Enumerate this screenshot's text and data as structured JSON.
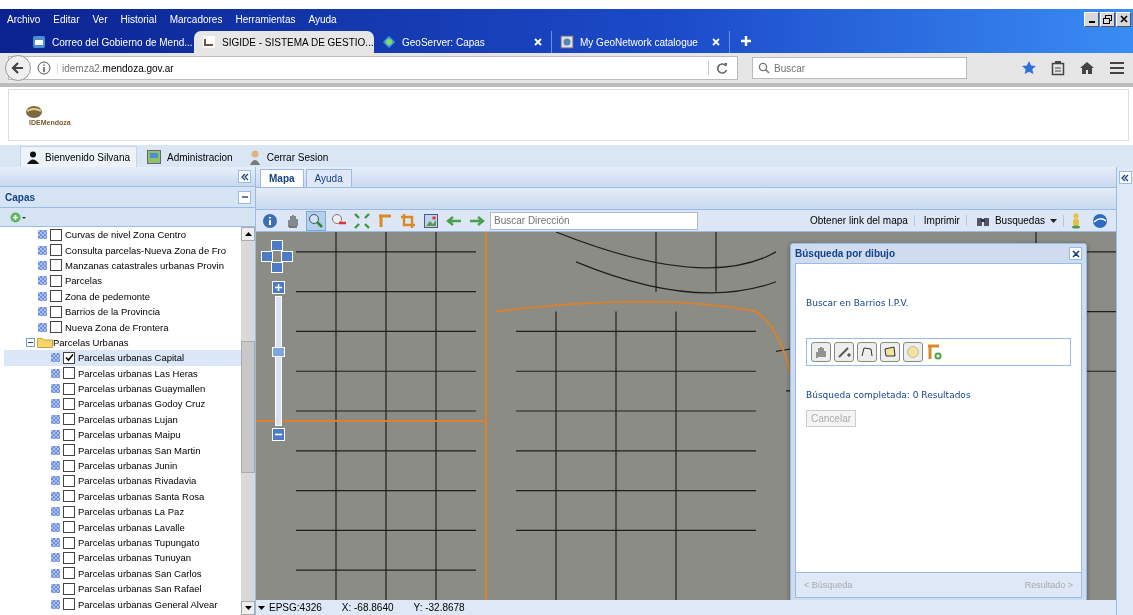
{
  "browser": {
    "menu": [
      "Archivo",
      "Editar",
      "Ver",
      "Historial",
      "Marcadores",
      "Herramientas",
      "Ayuda"
    ],
    "tabs": [
      {
        "title": "Correo del Gobierno de Mend...",
        "selected": false,
        "kind": "mail"
      },
      {
        "title": "SIGIDE - SISTEMA DE GESTIO...",
        "selected": true,
        "kind": "sigide"
      },
      {
        "title": "GeoServer: Capas",
        "selected": false,
        "kind": "geoserver"
      },
      {
        "title": "My GeoNetwork catalogue",
        "selected": false,
        "kind": "geonetwork"
      }
    ],
    "address": {
      "subdomain": "idemza2.",
      "domain": "mendoza.gov.ar"
    },
    "search": {
      "placeholder": "Buscar"
    }
  },
  "app": {
    "logo_text": "IDEMendoza",
    "user_bar": [
      {
        "kind": "user",
        "label": "Bienvenido Silvana",
        "selected": true
      },
      {
        "kind": "admin",
        "label": "Administracion",
        "selected": false
      },
      {
        "kind": "logout",
        "label": "Cerrar Sesion",
        "selected": false
      }
    ],
    "left_panel": {
      "title": "Capas",
      "layers": [
        {
          "label": "Curvas de nivel Zona Centro",
          "checked": false,
          "selected": false
        },
        {
          "label": "Consulta parcelas-Nueva Zona de Fro",
          "checked": false,
          "selected": false
        },
        {
          "label": "Manzanas catastrales urbanas Provin",
          "checked": false,
          "selected": false
        },
        {
          "label": "Parcelas",
          "checked": false,
          "selected": false
        },
        {
          "label": "Zona de pedemonte",
          "checked": false,
          "selected": false
        },
        {
          "label": "Barrios de la Provincia",
          "checked": false,
          "selected": false
        },
        {
          "label": "Nueva Zona de Frontera",
          "checked": false,
          "selected": false
        },
        {
          "label": "Parcelas Urbanas",
          "expanded": true,
          "children": [
            {
              "label": "Parcelas urbanas Capital",
              "checked": true,
              "selected": true
            },
            {
              "label": "Parcelas urbanas Las Heras",
              "checked": false,
              "selected": false
            },
            {
              "label": "Parcelas urbanas Guaymallen",
              "checked": false,
              "selected": false
            },
            {
              "label": "Parcelas urbanas Godoy Cruz",
              "checked": false,
              "selected": false
            },
            {
              "label": "Parcelas urbanas Lujan",
              "checked": false,
              "selected": false
            },
            {
              "label": "Parcelas urbanas Maipu",
              "checked": false,
              "selected": false
            },
            {
              "label": "Parcelas urbanas San Martin",
              "checked": false,
              "selected": false
            },
            {
              "label": "Parcelas urbanas Junin",
              "checked": false,
              "selected": false
            },
            {
              "label": "Parcelas urbanas Rivadavia",
              "checked": false,
              "selected": false
            },
            {
              "label": "Parcelas urbanas Santa Rosa",
              "checked": false,
              "selected": false
            },
            {
              "label": "Parcelas urbanas La Paz",
              "checked": false,
              "selected": false
            },
            {
              "label": "Parcelas urbanas Lavalle",
              "checked": false,
              "selected": false
            },
            {
              "label": "Parcelas urbanas Tupungato",
              "checked": false,
              "selected": false
            },
            {
              "label": "Parcelas urbanas Tunuyan",
              "checked": false,
              "selected": false
            },
            {
              "label": "Parcelas urbanas San Carlos",
              "checked": false,
              "selected": false
            },
            {
              "label": "Parcelas urbanas San Rafael",
              "checked": false,
              "selected": false
            },
            {
              "label": "Parcelas urbanas General Alvear",
              "checked": false,
              "selected": false
            }
          ]
        }
      ]
    },
    "map_tabs": [
      {
        "label": "Mapa",
        "selected": true
      },
      {
        "label": "Ayuda",
        "selected": false
      }
    ],
    "map_tools": [
      {
        "kind": "info",
        "selected": false
      },
      {
        "kind": "pan",
        "selected": false
      },
      {
        "kind": "zoom-in",
        "selected": true
      },
      {
        "kind": "zoom-out",
        "selected": false
      },
      {
        "kind": "extent",
        "selected": false
      },
      {
        "kind": "measure",
        "selected": false
      },
      {
        "kind": "crop",
        "selected": false
      },
      {
        "kind": "image",
        "selected": false
      },
      {
        "kind": "back",
        "selected": false
      },
      {
        "kind": "forward",
        "selected": false
      }
    ],
    "address_search": {
      "placeholder": "Buscar Dirección"
    },
    "toolbar_buttons": [
      {
        "kind": "text",
        "label": "Obtener link del mapa"
      },
      {
        "kind": "text",
        "label": "Imprimir"
      },
      {
        "kind": "menu",
        "label": "Busquedas"
      }
    ],
    "zoom": {
      "level": 0.57
    },
    "status": {
      "projection": "EPSG:4326",
      "x": "X: -68.8640",
      "y": "Y: -32.8678"
    },
    "dialog": {
      "title": "Búsqueda por dibujo",
      "layer_text": "Buscar en Barrios I.P.V.",
      "result_text": "Búsqueda completada: 0 Resultados",
      "cancel": {
        "label": "Cancelar",
        "disabled": true
      },
      "prev": {
        "label": "< Búsqueda",
        "disabled": true
      },
      "next": {
        "label": "Resultado >",
        "disabled": true
      }
    }
  }
}
